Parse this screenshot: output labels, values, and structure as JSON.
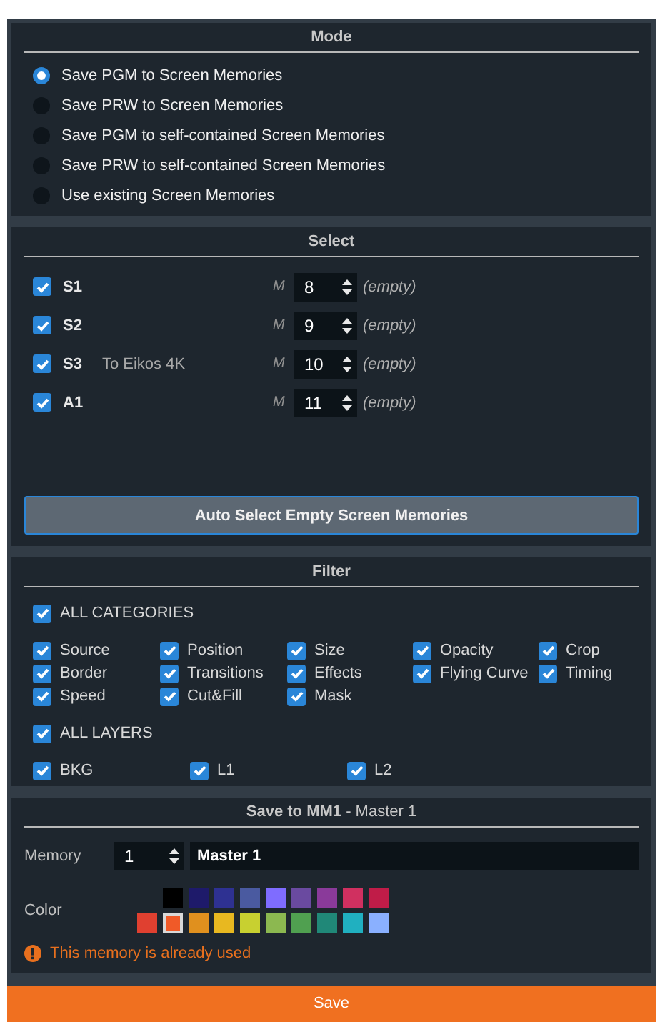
{
  "mode": {
    "title": "Mode",
    "options": [
      {
        "label": "Save PGM to Screen Memories",
        "selected": true
      },
      {
        "label": "Save PRW to Screen Memories",
        "selected": false
      },
      {
        "label": "Save PGM to self-contained Screen Memories",
        "selected": false
      },
      {
        "label": "Save PRW to self-contained Screen Memories",
        "selected": false
      },
      {
        "label": "Use existing Screen Memories",
        "selected": false
      }
    ]
  },
  "select": {
    "title": "Select",
    "rows": [
      {
        "name": "S1",
        "checked": true,
        "m": "M",
        "value": "8",
        "status": "(empty)"
      },
      {
        "name": "S2",
        "checked": true,
        "m": "M",
        "value": "9",
        "status": "(empty)"
      },
      {
        "name": "S3",
        "note": "To Eikos 4K",
        "checked": true,
        "m": "M",
        "value": "10",
        "status": "(empty)"
      },
      {
        "name": "A1",
        "checked": true,
        "m": "M",
        "value": "11",
        "status": "(empty)"
      }
    ],
    "button": "Auto Select Empty Screen Memories"
  },
  "filter": {
    "title": "Filter",
    "all_categories": {
      "label": "ALL CATEGORIES",
      "checked": true
    },
    "categories": [
      {
        "label": "Source",
        "checked": true
      },
      {
        "label": "Position",
        "checked": true
      },
      {
        "label": "Size",
        "checked": true
      },
      {
        "label": "Opacity",
        "checked": true
      },
      {
        "label": "Crop",
        "checked": true
      },
      {
        "label": "Border",
        "checked": true
      },
      {
        "label": "Transitions",
        "checked": true
      },
      {
        "label": "Effects",
        "checked": true
      },
      {
        "label": "Flying Curve",
        "checked": true
      },
      {
        "label": "Timing",
        "checked": true
      },
      {
        "label": "Speed",
        "checked": true
      },
      {
        "label": "Cut&Fill",
        "checked": true
      },
      {
        "label": "Mask",
        "checked": true
      }
    ],
    "all_layers": {
      "label": "ALL LAYERS",
      "checked": true
    },
    "layers": [
      {
        "label": "BKG",
        "checked": true
      },
      {
        "label": "L1",
        "checked": true
      },
      {
        "label": "L2",
        "checked": true
      }
    ]
  },
  "save": {
    "title": "**Save to MM1** - Master 1",
    "memory_label": "Memory",
    "memory_number": "1",
    "memory_name": "Master 1",
    "color_label": "Color",
    "color_rows": [
      [
        {
          "color": "#000000",
          "selected": false
        },
        {
          "color": "#1e1a6a",
          "selected": false
        },
        {
          "color": "#2e3192",
          "selected": false
        },
        {
          "color": "#4a5aa0",
          "selected": false
        },
        {
          "color": "#7f6cff",
          "selected": false
        },
        {
          "color": "#6a4aa0",
          "selected": false
        },
        {
          "color": "#8a3a9a",
          "selected": false
        },
        {
          "color": "#d03060",
          "selected": false
        },
        {
          "color": "#c01c48",
          "selected": false
        }
      ],
      [
        {
          "color": "#e04030",
          "selected": false
        },
        {
          "color": "#f05a28",
          "selected": true
        },
        {
          "color": "#e0901e",
          "selected": false
        },
        {
          "color": "#e8b820",
          "selected": false
        },
        {
          "color": "#c8d030",
          "selected": false
        },
        {
          "color": "#8cb850",
          "selected": false
        },
        {
          "color": "#50a050",
          "selected": false
        },
        {
          "color": "#208878",
          "selected": false
        },
        {
          "color": "#20b0c0",
          "selected": false
        },
        {
          "color": "#8ab0ff",
          "selected": false
        }
      ]
    ],
    "warning": "This memory is already used"
  },
  "save_button": "Save"
}
